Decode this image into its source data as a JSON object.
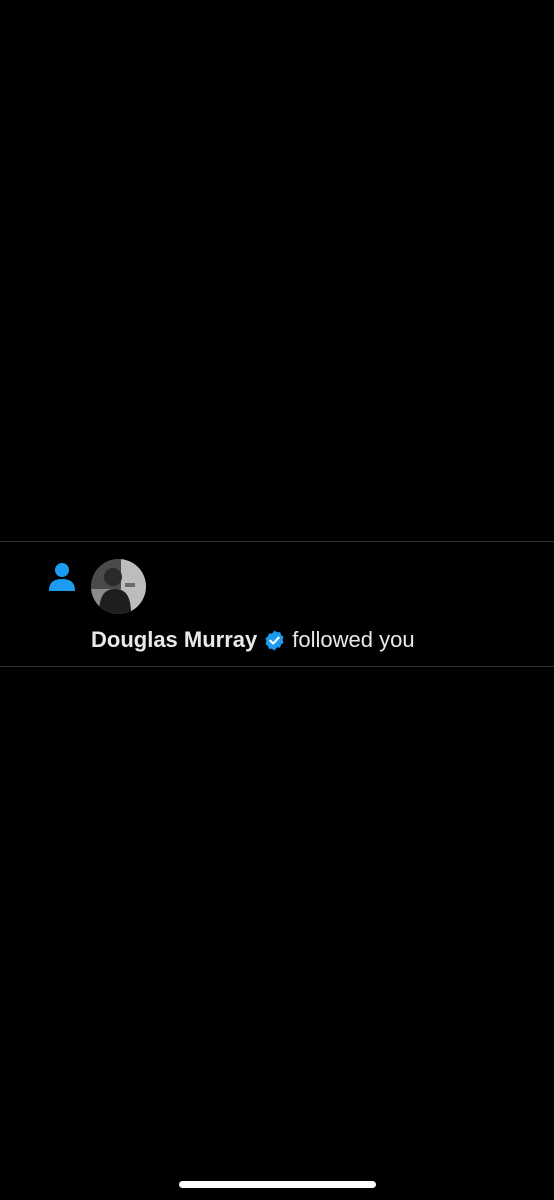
{
  "notification": {
    "type_icon": "person-icon",
    "avatar_icon": "user-avatar",
    "user_name": "Douglas Murray",
    "verified_icon": "verified-badge-icon",
    "action_text": "followed you"
  },
  "colors": {
    "accent": "#1d9bf0",
    "background": "#000000",
    "divider": "#2f3336",
    "text": "#e7e9ea"
  }
}
